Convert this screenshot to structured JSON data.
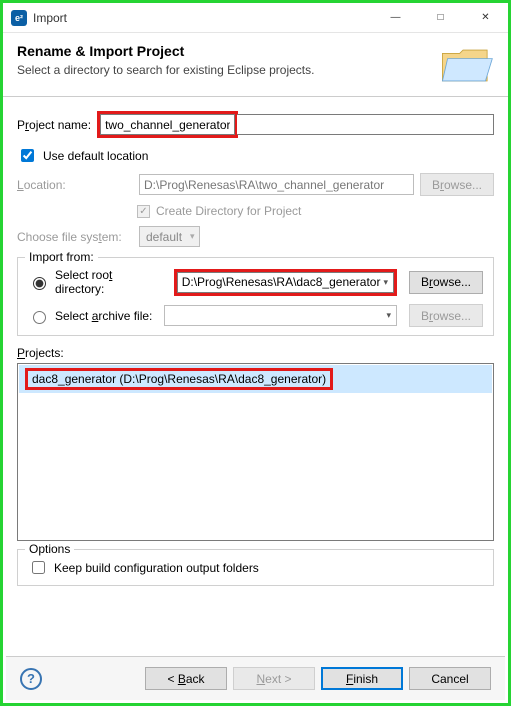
{
  "window": {
    "title": "Import"
  },
  "header": {
    "title": "Rename & Import Project",
    "subtitle": "Select a directory to search for existing Eclipse projects."
  },
  "projectName": {
    "label_pre": "P",
    "label_underlined": "r",
    "label_post": "oject name:",
    "value": "two_channel_generator"
  },
  "defaultLocation": {
    "label": "Use default location",
    "checked": true
  },
  "location": {
    "label_underlined": "L",
    "label_post": "ocation:",
    "value": "D:\\Prog\\Renesas\\RA\\two_channel_generator",
    "browse_pre": "B",
    "browse_u": "r",
    "browse_post": "owse..."
  },
  "createDir": {
    "label": "Create Directory for Project"
  },
  "fileSystem": {
    "label_pre": "Choose file sys",
    "label_u": "t",
    "label_post": "em:",
    "value": "default"
  },
  "importFrom": {
    "legend": "Import from:",
    "rootDir": {
      "label_pre": "Select roo",
      "label_u": "t",
      "label_post": " directory:",
      "value": "D:\\Prog\\Renesas\\RA\\dac8_generator",
      "browse_pre": "B",
      "browse_u": "r",
      "browse_post": "owse..."
    },
    "archive": {
      "label_pre": "Select ",
      "label_u": "a",
      "label_post": "rchive file:",
      "value": "",
      "browse_pre": "B",
      "browse_u": "r",
      "browse_post": "owse..."
    }
  },
  "projects": {
    "label_underlined": "P",
    "label_post": "rojects:",
    "items": [
      "dac8_generator (D:\\Prog\\Renesas\\RA\\dac8_generator)"
    ]
  },
  "options": {
    "legend": "Options",
    "keepBuild": "Keep build configuration output folders"
  },
  "footer": {
    "back_pre": "< ",
    "back_u": "B",
    "back_post": "ack",
    "next_pre": "",
    "next_u": "N",
    "next_post": "ext >",
    "finish_u": "F",
    "finish_post": "inish",
    "cancel": "Cancel"
  }
}
